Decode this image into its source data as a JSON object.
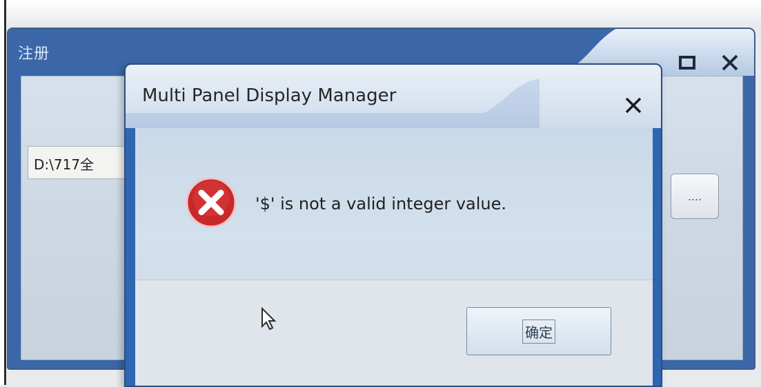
{
  "parent_window": {
    "title": "注册",
    "path_value": "D:\\717全",
    "browse_label": "....",
    "minimize_icon": "minimize-icon",
    "maximize_icon": "maximize-icon",
    "close_icon": "close-icon"
  },
  "dialog": {
    "title": "Multi Panel Display Manager",
    "message": "'$' is not a valid integer value.",
    "ok_label": "确定",
    "icon": "error-icon",
    "close_icon": "close-icon"
  },
  "colors": {
    "title_accent": "#3b67a8",
    "dialog_body": "#d3e0ed",
    "error_red": "#c8282a"
  }
}
